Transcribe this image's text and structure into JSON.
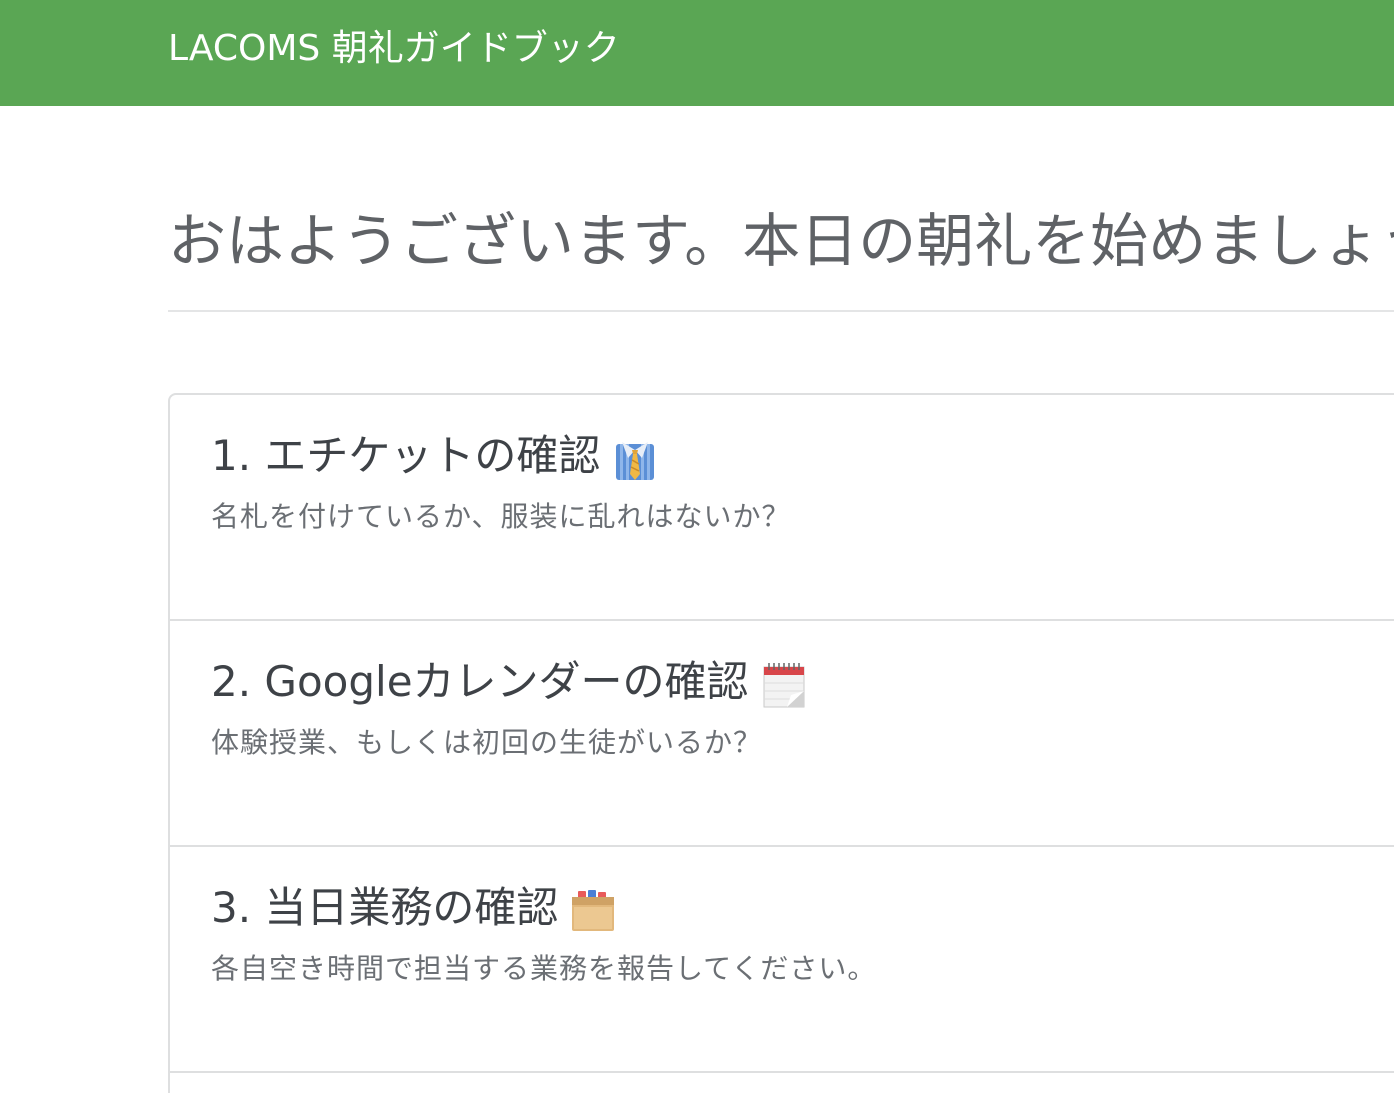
{
  "navbar": {
    "brand": "LACOMS 朝礼ガイドブック",
    "color": "#5aa654"
  },
  "main": {
    "title": "おはようございます。本日の朝礼を始めましょう",
    "items": [
      {
        "heading": "1. エチケットの確認",
        "icon": "necktie-shirt-icon",
        "description": "名札を付けているか、服装に乱れはないか？"
      },
      {
        "heading": "2. Googleカレンダーの確認",
        "icon": "calendar-icon",
        "description": "体験授業、もしくは初回の生徒がいるか？"
      },
      {
        "heading": "3. 当日業務の確認",
        "icon": "card-file-box-icon",
        "description": "各自空き時間で担当する業務を報告してください。"
      }
    ]
  }
}
